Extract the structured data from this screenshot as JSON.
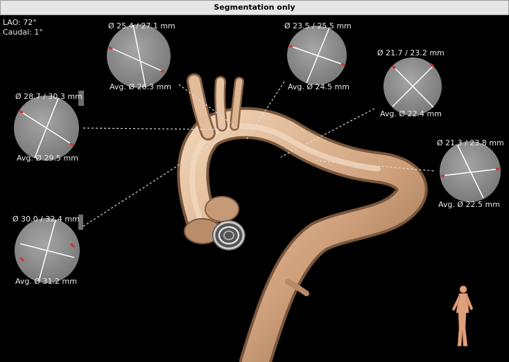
{
  "window": {
    "title": "Segmentation only"
  },
  "view": {
    "lao": "LAO: 72°",
    "caudal": "Caudal: 1°"
  },
  "cross_sections": [
    {
      "id": "s1",
      "diameter": "Ø 25.4 / 27.1 mm",
      "avg": "Avg. Ø 26.3 mm"
    },
    {
      "id": "s2",
      "diameter": "Ø 23.5 / 25.5 mm",
      "avg": "Avg. Ø 24.5 mm"
    },
    {
      "id": "s3",
      "diameter": "Ø 21.7 / 23.2 mm",
      "avg": "Avg. Ø 22.4 mm"
    },
    {
      "id": "s4",
      "diameter": "Ø 28.7 / 30.3 mm",
      "avg": "Avg. Ø 29.5 mm"
    },
    {
      "id": "s5",
      "diameter": "Ø 21.3 / 23.8 mm",
      "avg": "Avg. Ø 22.5 mm"
    },
    {
      "id": "s6",
      "diameter": "Ø 30.0 / 32.4 mm",
      "avg": "Avg. Ø 31.2 mm"
    }
  ],
  "colors": {
    "background": "#000000",
    "vessel": "#d9b090",
    "section_fill": "#8e8e8e",
    "marker": "#d23030",
    "label": "#e8e8e8"
  },
  "icons": {
    "orientation": "human-figure-icon"
  }
}
